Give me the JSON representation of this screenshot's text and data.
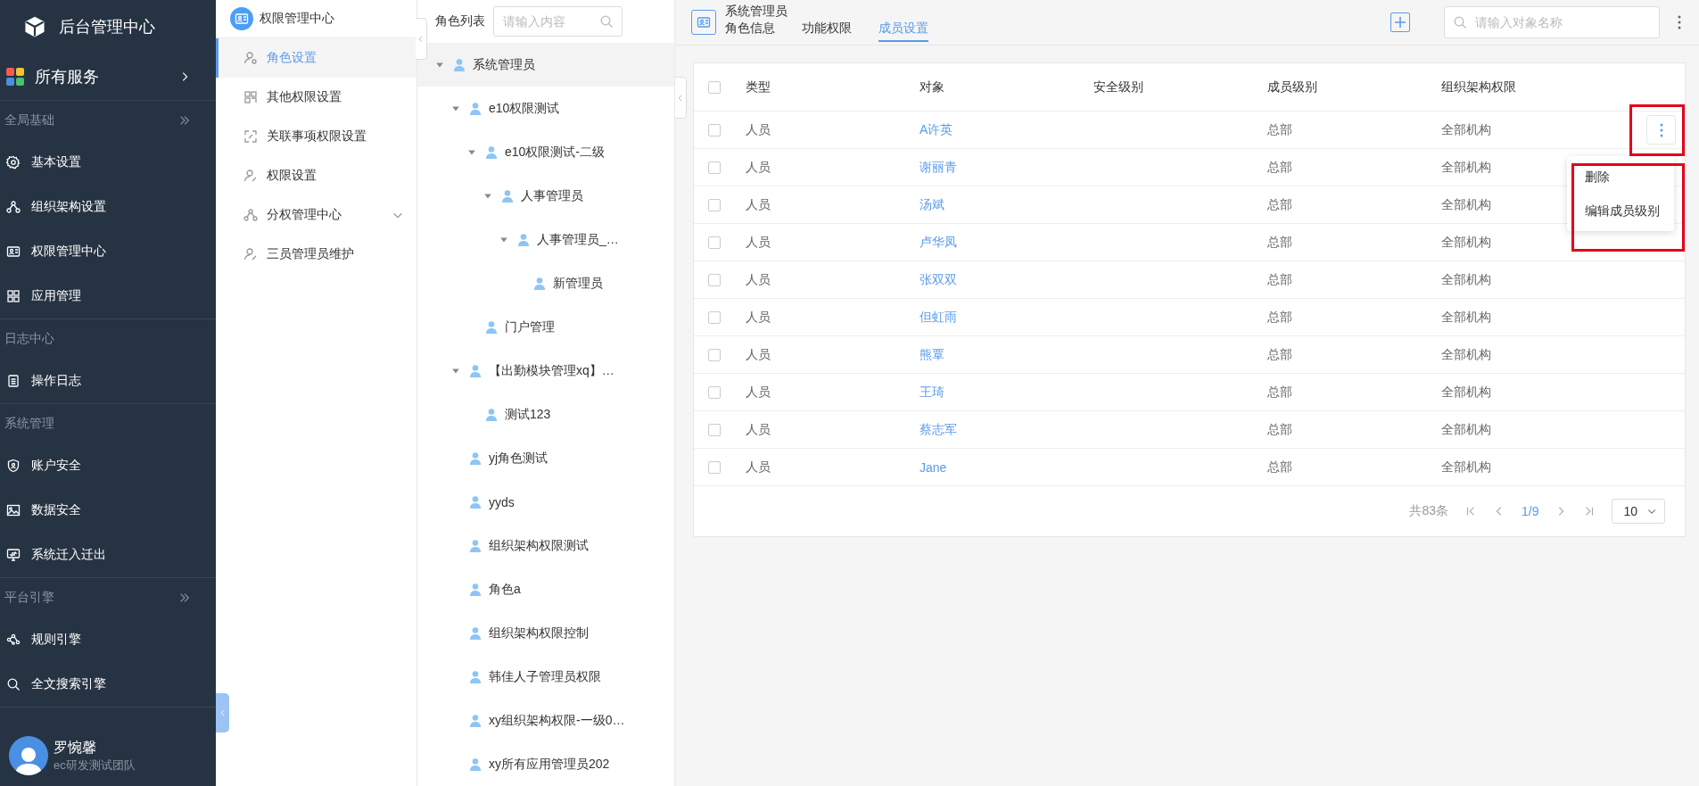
{
  "brand": {
    "title": "后台管理中心"
  },
  "all_services": {
    "label": "所有服务"
  },
  "sidebar": {
    "sections": [
      {
        "label": "全局基础",
        "collapsible": true,
        "items": [
          {
            "label": "基本设置"
          },
          {
            "label": "组织架构设置"
          },
          {
            "label": "权限管理中心"
          },
          {
            "label": "应用管理"
          }
        ]
      },
      {
        "label": "日志中心",
        "collapsible": false,
        "items": [
          {
            "label": "操作日志"
          }
        ]
      },
      {
        "label": "系统管理",
        "collapsible": false,
        "items": [
          {
            "label": "账户安全"
          },
          {
            "label": "数据安全"
          },
          {
            "label": "系统迁入迁出"
          }
        ]
      },
      {
        "label": "平台引擎",
        "collapsible": true,
        "items": [
          {
            "label": "规则引擎"
          },
          {
            "label": "全文搜索引擎"
          }
        ]
      }
    ]
  },
  "user": {
    "name": "罗惋馨",
    "team": "ec研发测试团队"
  },
  "submenu": {
    "title": "权限管理中心",
    "items": [
      {
        "label": "角色设置",
        "selected": true,
        "kind": "link"
      },
      {
        "label": "其他权限设置",
        "selected": false,
        "kind": "link"
      },
      {
        "label": "关联事项权限设置",
        "selected": false,
        "kind": "link"
      },
      {
        "label": "权限设置",
        "selected": false,
        "kind": "link"
      },
      {
        "label": "分权管理中心",
        "selected": false,
        "kind": "group"
      },
      {
        "label": "三员管理员维护",
        "selected": false,
        "kind": "link"
      }
    ]
  },
  "role_list": {
    "title": "角色列表",
    "search": {
      "placeholder": "请输入内容"
    },
    "tree": [
      {
        "label": "系统管理员",
        "selected": true,
        "expanded": true,
        "children": [
          {
            "label": "e10权限测试",
            "selected": false,
            "expanded": true,
            "children": [
              {
                "label": "e10权限测试-二级",
                "selected": false,
                "expanded": true,
                "children": [
                  {
                    "label": "人事管理员",
                    "selected": false,
                    "expanded": true,
                    "children": [
                      {
                        "label": "人事管理员_…",
                        "selected": false,
                        "expanded": true,
                        "children": [
                          {
                            "label": "新管理员",
                            "selected": false
                          }
                        ]
                      }
                    ]
                  }
                ]
              },
              {
                "label": "门户管理",
                "selected": false
              }
            ]
          },
          {
            "label": "【出勤模块管理xq】…",
            "selected": false,
            "expanded": true,
            "children": [
              {
                "label": "测试123",
                "selected": false
              }
            ]
          },
          {
            "label": "yj角色测试",
            "selected": false
          },
          {
            "label": "yyds",
            "selected": false
          },
          {
            "label": "组织架构权限测试",
            "selected": false
          },
          {
            "label": "角色a",
            "selected": false
          },
          {
            "label": "组织架构权限控制",
            "selected": false
          },
          {
            "label": "韩佳人子管理员权限",
            "selected": false
          },
          {
            "label": "xy组织架构权限-一级0…",
            "selected": false
          },
          {
            "label": "xy所有应用管理员202",
            "selected": false
          }
        ]
      }
    ]
  },
  "detail": {
    "title": "系统管理员",
    "tabs": [
      {
        "label": "角色信息",
        "selected": false
      },
      {
        "label": "功能权限",
        "selected": false
      },
      {
        "label": "成员设置",
        "selected": true
      }
    ],
    "search": {
      "placeholder": "请输入对象名称"
    },
    "table": {
      "all_checked": false,
      "columns": [
        "类型",
        "对象",
        "安全级别",
        "成员级别",
        "组织架构权限"
      ],
      "rows": [
        {
          "checked": false,
          "type": "人员",
          "object": "A许英",
          "member_level": "总部",
          "org_permission": "全部机构",
          "actions": {
            "highlighted": true,
            "menu": {
              "highlighted": true,
              "items": [
                "删除",
                "编辑成员级别"
              ]
            }
          }
        },
        {
          "checked": false,
          "type": "人员",
          "object": "谢丽青",
          "member_level": "总部",
          "org_permission": "全部机构"
        },
        {
          "checked": false,
          "type": "人员",
          "object": "汤斌",
          "member_level": "总部",
          "org_permission": "全部机构"
        },
        {
          "checked": false,
          "type": "人员",
          "object": "卢华凤",
          "member_level": "总部",
          "org_permission": "全部机构"
        },
        {
          "checked": false,
          "type": "人员",
          "object": "张双双",
          "member_level": "总部",
          "org_permission": "全部机构"
        },
        {
          "checked": false,
          "type": "人员",
          "object": "但虹雨",
          "member_level": "总部",
          "org_permission": "全部机构"
        },
        {
          "checked": false,
          "type": "人员",
          "object": "熊覃",
          "member_level": "总部",
          "org_permission": "全部机构"
        },
        {
          "checked": false,
          "type": "人员",
          "object": "王琦",
          "member_level": "总部",
          "org_permission": "全部机构"
        },
        {
          "checked": false,
          "type": "人员",
          "object": "蔡志军",
          "member_level": "总部",
          "org_permission": "全部机构"
        },
        {
          "checked": false,
          "type": "人员",
          "object": "Jane",
          "member_level": "总部",
          "org_permission": "全部机构"
        }
      ]
    },
    "pagination": {
      "total": "共83条",
      "page": "1/9",
      "page_size": "10"
    }
  }
}
